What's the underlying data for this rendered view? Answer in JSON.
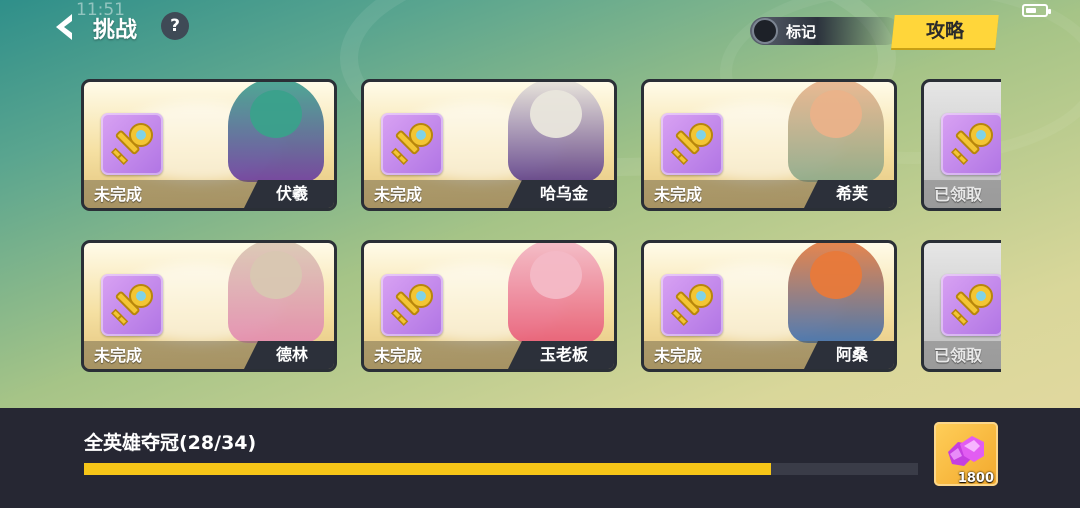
{
  "status_bar": {
    "time": "11:51",
    "battery_level": 0.55
  },
  "header": {
    "title": "挑战",
    "help_symbol": "?",
    "mark_label": "标记",
    "guide_label": "攻略"
  },
  "colors": {
    "accent_yellow": "#ffd63a",
    "progress_fill": "#f5c518",
    "panel_bg": "#262733",
    "key_box": "#c08ae9"
  },
  "cards": [
    {
      "status": "未完成",
      "hero": "伏羲",
      "hero_color": "#3aa18b",
      "hero_accent": "#6b3aa0"
    },
    {
      "status": "未完成",
      "hero": "哈乌金",
      "hero_color": "#e9e6dc",
      "hero_accent": "#5b3c8a"
    },
    {
      "status": "未完成",
      "hero": "希芙",
      "hero_color": "#eab28a",
      "hero_accent": "#8aa98a"
    },
    {
      "status": "已领取",
      "hero": "",
      "hero_color": "#bdbdbd",
      "hero_accent": "#999999"
    },
    {
      "status": "未完成",
      "hero": "德林",
      "hero_color": "#d8c7b2",
      "hero_accent": "#e38ab0"
    },
    {
      "status": "未完成",
      "hero": "玉老板",
      "hero_color": "#f3b9c6",
      "hero_accent": "#e85a77"
    },
    {
      "status": "未完成",
      "hero": "阿桑",
      "hero_color": "#e8793a",
      "hero_accent": "#3d6fb0"
    },
    {
      "status": "已领取",
      "hero": "",
      "hero_color": "#bdbdbd",
      "hero_accent": "#999999"
    }
  ],
  "progress": {
    "title": "全英雄夺冠(28/34)",
    "completed": 28,
    "total": 34,
    "reward_amount": "1800",
    "reward_icon": "purple-gem-icon"
  }
}
